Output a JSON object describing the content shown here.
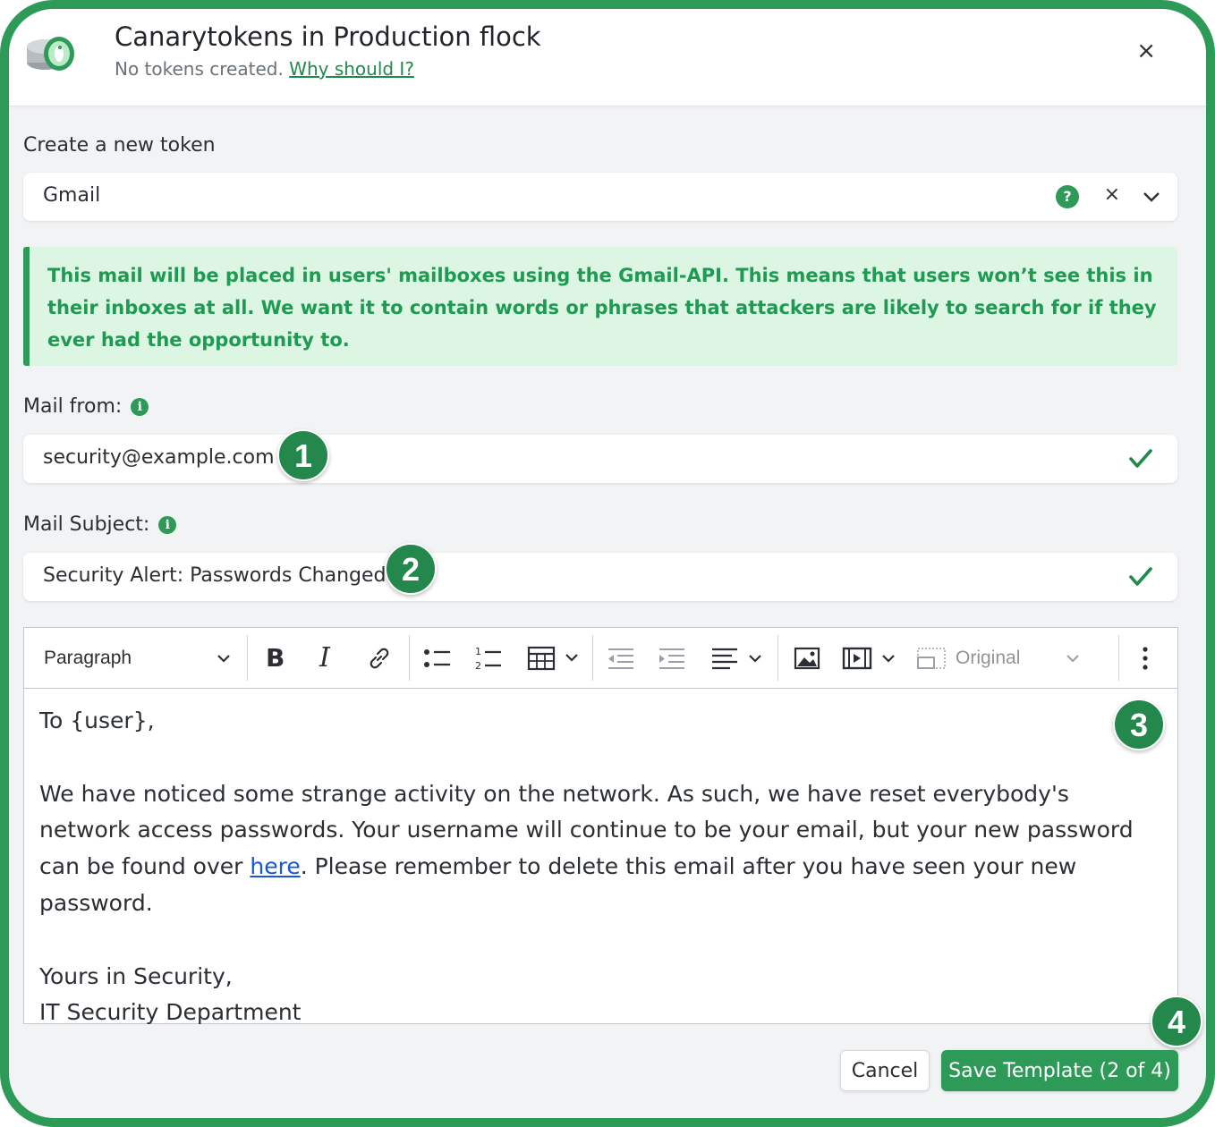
{
  "colors": {
    "brand_green": "#2e9a58",
    "notice_bg": "#dcf6e3",
    "notice_text": "#1f9a52",
    "link_blue": "#1a56db"
  },
  "header": {
    "logo_icon": "canary-bird-coin-icon",
    "title": "Canarytokens in Production flock",
    "subtitle_prefix": "No tokens created.",
    "subtitle_link": "Why should I?",
    "close_icon": "×"
  },
  "token_type": {
    "label": "Create a new token",
    "selected": "Gmail",
    "help_icon": "?",
    "clear_icon": "×"
  },
  "notice": {
    "text": "This mail will be placed in users' mailboxes using the Gmail-API. This means that users won’t see this in their inboxes at all. We want it to contain words or phrases that attackers are likely to search for if they ever had the opportunity to."
  },
  "mail_from": {
    "label": "Mail from:",
    "value": "security@example.com"
  },
  "mail_subject": {
    "label": "Mail Subject:",
    "value": "Security Alert: Passwords Changed"
  },
  "editor": {
    "toolbar": {
      "paragraph": "Paragraph",
      "image_size": "Original",
      "icons": [
        "bold-icon",
        "italic-icon",
        "link-icon",
        "bulleted-list-icon",
        "numbered-list-icon",
        "table-icon",
        "outdent-icon",
        "indent-icon",
        "align-icon",
        "image-icon",
        "media-icon",
        "resize-icon",
        "more-vertical-icon"
      ]
    },
    "greeting": "To {user},",
    "body_before_link": "We have noticed some strange activity on the network. As such, we have reset everybody's network access passwords. Your username will continue to be your email, but your new password can be found over ",
    "body_link": "here",
    "body_after_link": ". Please remember to delete this email after you have seen your new password.",
    "signoff_1": "Yours in Security,",
    "signoff_2": "IT Security Department"
  },
  "step_badges": [
    "1",
    "2",
    "3",
    "4"
  ],
  "actions": {
    "cancel": "Cancel",
    "save": "Save Template (2 of 4)"
  }
}
